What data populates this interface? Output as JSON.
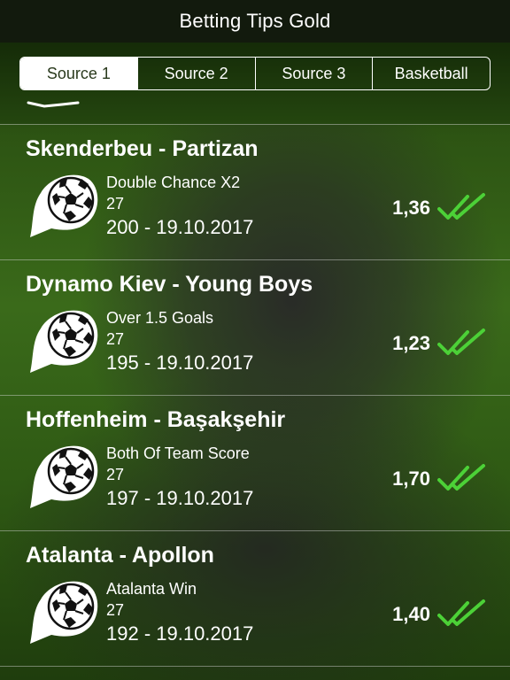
{
  "app": {
    "title": "Betting Tips Gold"
  },
  "segments": [
    {
      "label": "Source 1",
      "active": true
    },
    {
      "label": "Source 2",
      "active": false
    },
    {
      "label": "Source 3",
      "active": false
    },
    {
      "label": "Basketball",
      "active": false
    }
  ],
  "tips": [
    {
      "match": "Skenderbeu - Partizan",
      "tip": "Double Chance X2",
      "number": "27",
      "date_line": "200 - 19.10.2017",
      "odds": "1,36",
      "status": "won"
    },
    {
      "match": "Dynamo Kiev - Young Boys",
      "tip": "Over 1.5 Goals",
      "number": "27",
      "date_line": "195 - 19.10.2017",
      "odds": "1,23",
      "status": "won"
    },
    {
      "match": "Hoffenheim - Başakşehir",
      "tip": "Both Of Team Score",
      "number": "27",
      "date_line": "197 - 19.10.2017",
      "odds": "1,70",
      "status": "won"
    },
    {
      "match": "Atalanta  - Apollon",
      "tip": "Atalanta Win",
      "number": "27",
      "date_line": "192 - 19.10.2017",
      "odds": "1,40",
      "status": "won"
    }
  ],
  "colors": {
    "check": "#4cd137",
    "nav": "#121a0d",
    "accent_text": "#2a3a1d"
  },
  "icons": {
    "ball": "soccer-ball-icon",
    "check": "double-check-icon"
  }
}
